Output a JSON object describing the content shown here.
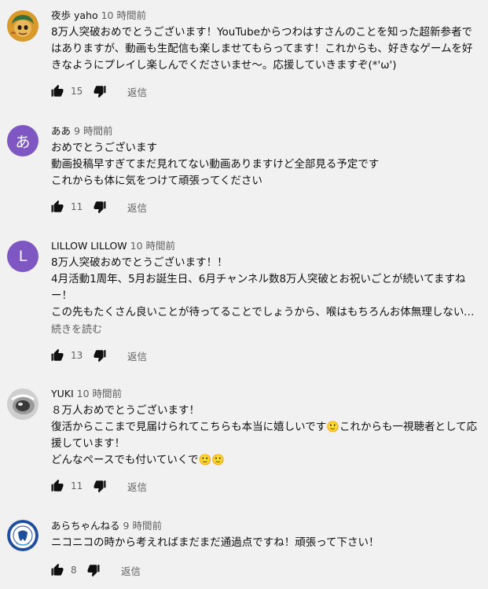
{
  "icons": {
    "like": "thumb-up-icon",
    "dislike": "thumb-down-icon"
  },
  "colors": {
    "background": "#f1f1f1",
    "text": "#0f0f0f",
    "muted": "#606060",
    "avatar_a": "#7e57c2",
    "avatar_l": "#7e57c2"
  },
  "reply_label": "返信",
  "read_more_label": "続きを読む",
  "comments": [
    {
      "author": "夜歩 yaho",
      "time": "10 時間前",
      "text": "8万人突破おめでとうございます！YouTubeからつわはすさんのことを知った超新参者ではありますが、動画も生配信も楽しませてもらってます！これからも、好きなゲームを好きなようにプレイし楽しんでくださいませ～。応援していきますぞ(*'ω')",
      "likes": "15"
    },
    {
      "author": "ああ",
      "time": "9 時間前",
      "avatar_letter": "あ",
      "text": "おめでとうございます\n動画投稿早すぎてまだ見れてない動画ありますけど全部見る予定です\nこれからも体に気をつけて頑張ってください",
      "likes": "11"
    },
    {
      "author": "LILLOW LILLOW",
      "time": "10 時間前",
      "avatar_letter": "L",
      "text": "8万人突破おめでとうございます！！\n4月活動1周年、5月お誕生日、6月チャンネル数8万人突破とお祝いごとが続いてますねー！\nこの先もたくさん良いことが待ってることでしょうから、喉はもちろんお体無理しないでくださいね",
      "likes": "13"
    },
    {
      "author": "YUKI",
      "time": "10 時間前",
      "text": "８万人おめでとうございます！\n復活からここまで見届けられてこちらも本当に嬉しいです🙂これからも一視聴者として応援しています！\nどんなペースでも付いていくで🙂🙂",
      "likes": "11"
    },
    {
      "author": "あらちゃんねる",
      "time": "9 時間前",
      "text": "ニコニコの時から考えればまだまだ通過点ですね！頑張って下さい！",
      "likes": "8"
    }
  ]
}
